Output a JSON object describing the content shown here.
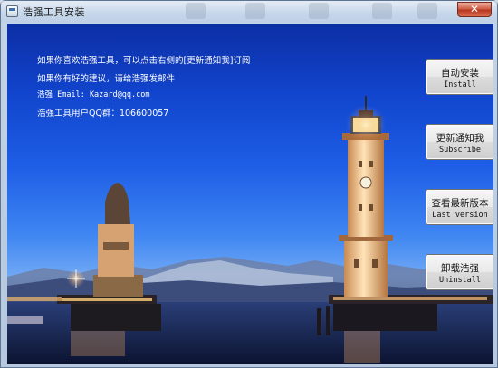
{
  "window": {
    "title": "浩强工具安装",
    "close_label": "✕"
  },
  "info": {
    "line1": "如果你喜欢浩强工具，可以点击右侧的[更新通知我]订阅",
    "line2": "如果你有好的建议，请给浩强发邮件",
    "line3": "浩强 Email: Kazard@qq.com",
    "line4": "浩强工具用户QQ群：106600057"
  },
  "buttons": {
    "install": {
      "cn": "自动安装",
      "en": "Install"
    },
    "subscribe": {
      "cn": "更新通知我",
      "en": "Subscribe"
    },
    "last_version": {
      "cn": "查看最新版本",
      "en": "Last version"
    },
    "uninstall": {
      "cn": "卸载浩强",
      "en": "Uninstall"
    }
  },
  "background": {
    "sky_top": "#0c2ea4",
    "sky_mid": "#3f86f2",
    "water": "#0e1838",
    "lighthouse_glow": "#ffb070"
  }
}
